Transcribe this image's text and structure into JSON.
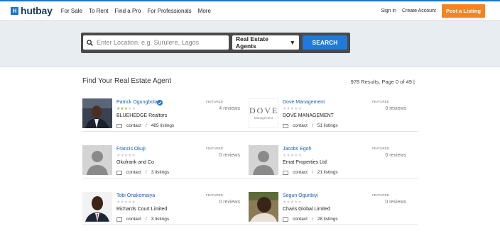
{
  "brand": {
    "logo_letter": "H",
    "name": "hutbay"
  },
  "nav": [
    "For Sale",
    "To Rent",
    "Find a Pro",
    "For Professionals",
    "More"
  ],
  "account": {
    "signin": "Sign in",
    "create": "Create Account",
    "post": "Post a Listing"
  },
  "search": {
    "placeholder": "Enter Location. e.g. Surulere, Lagos",
    "category": "Real Estate Agents",
    "button": "SEARCH"
  },
  "results": {
    "heading": "Find Your Real Estate Agent",
    "count": "978 Results. Page 0 of 49  |"
  },
  "agents": [
    {
      "name": "Patrick Ogungbola",
      "company": "BLUEHEDGE Realtors",
      "featured": "FEATURED",
      "reviews": "4 reviews",
      "contact": "contact",
      "listings": "485 listings",
      "rating": 3,
      "verified": true
    },
    {
      "name": "Dove Management",
      "company": "DOVE MANAGEMENT",
      "featured": "FEATURED",
      "reviews": "0 reviews",
      "contact": "contact",
      "listings": "51 listings",
      "rating": 0,
      "logo_text": "DOVE",
      "logo_sub": "Management"
    },
    {
      "name": "Francis Okuji",
      "company": "Okufrank and Co",
      "featured": "FEATURED",
      "reviews": "0 reviews",
      "contact": "contact",
      "listings": "3 listings",
      "rating": 0
    },
    {
      "name": "Jacobs Egoh",
      "company": "Emat Properties Ltd",
      "featured": "FEATURED",
      "reviews": "0 reviews",
      "contact": "contact",
      "listings": "21 listings",
      "rating": 0
    },
    {
      "name": "Tobi Onakomaiya",
      "company": "Richards Court Limited",
      "featured": "FEATURED",
      "reviews": "0 reviews",
      "contact": "contact",
      "listings": "3 listings",
      "rating": 0
    },
    {
      "name": "Segun Ogunbiyi",
      "company": "Charis Global Limited",
      "featured": "FEATURED",
      "reviews": "0 reviews",
      "contact": "contact",
      "listings": "28 listings",
      "rating": 0
    }
  ],
  "colors": {
    "accent": "#1a75cf",
    "post": "#f5841f",
    "link": "#1a5fb4",
    "star_on": "#8cc152"
  }
}
